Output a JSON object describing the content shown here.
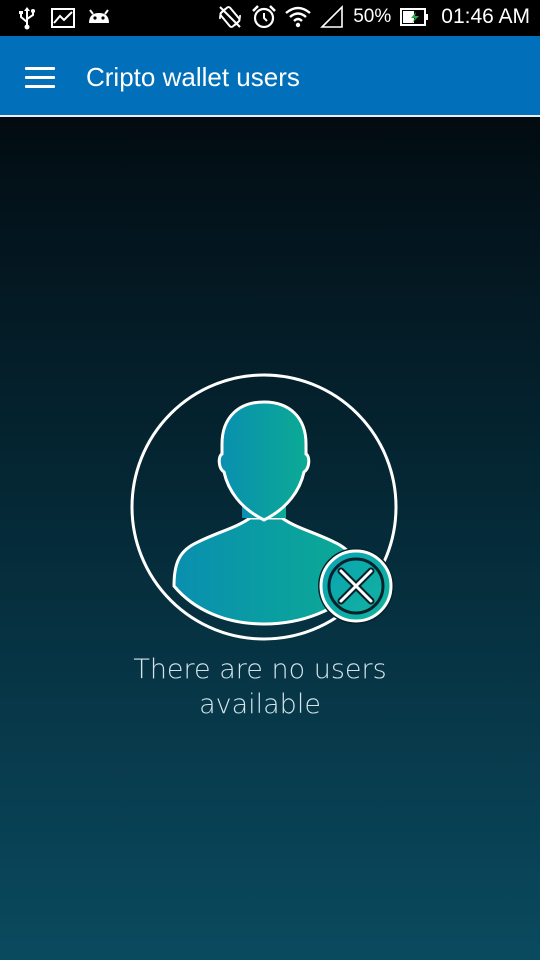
{
  "status_bar": {
    "left_icons": [
      "usb-icon",
      "chart-icon",
      "android-icon"
    ],
    "right_icons": [
      "rotate-icon",
      "alarm-icon",
      "wifi-icon",
      "signal-icon"
    ],
    "battery_percent": "50%",
    "time": "01:46 AM"
  },
  "app_bar": {
    "menu_icon": "hamburger-menu-icon",
    "title": "Cripto wallet users",
    "background_color": "#016fba"
  },
  "empty_state": {
    "icon": "user-removed-icon",
    "message_line1": "There are no users",
    "message_line2": "available",
    "accent_color": "#0aa6a0"
  }
}
